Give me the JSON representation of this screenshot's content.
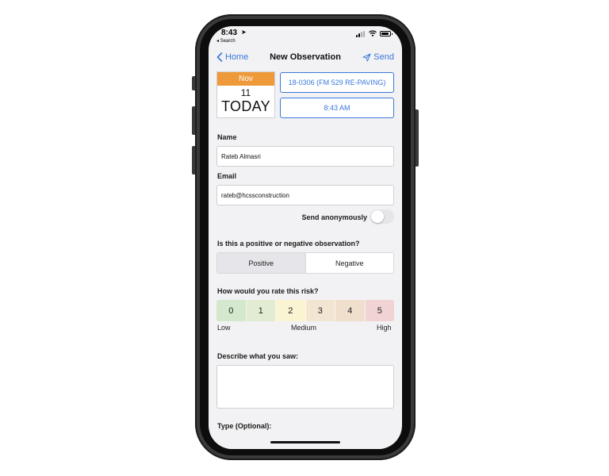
{
  "status_bar": {
    "time": "8:43",
    "location_glyph": "➤",
    "back_label": "◂ Search"
  },
  "nav": {
    "back_label": "Home",
    "title": "New Observation",
    "send_label": "Send"
  },
  "date_tile": {
    "month": "Nov",
    "day": "11",
    "label": "TODAY"
  },
  "job_button_label": "18-0306 (FM 529 RE-PAVING)",
  "time_button_label": "8:43 AM",
  "form": {
    "name_label": "Name",
    "name_value": "Rateb Almasri",
    "email_label": "Email",
    "email_value": "rateb@hcssconstruction",
    "anonymous_label": "Send anonymously",
    "anonymous_on": false,
    "polarity_question": "Is this a positive or negative observation?",
    "polarity_options": [
      "Positive",
      "Negative"
    ],
    "polarity_selected": "Negative",
    "risk_question": "How would you rate this risk?",
    "risk_levels": [
      {
        "value": "0",
        "color": "#d4e8cd"
      },
      {
        "value": "1",
        "color": "#e2ecd2"
      },
      {
        "value": "2",
        "color": "#fbf4d2"
      },
      {
        "value": "3",
        "color": "#f2e6d2"
      },
      {
        "value": "4",
        "color": "#efdfcc"
      },
      {
        "value": "5",
        "color": "#f1d3d3"
      }
    ],
    "risk_low": "Low",
    "risk_medium": "Medium",
    "risk_high": "High",
    "describe_label": "Describe what you saw:",
    "describe_value": "",
    "type_label": "Type (Optional):"
  },
  "colors": {
    "accent": "#3a78d8",
    "calendar_header": "#ef9a3a",
    "screen_background": "#f2f2f4"
  },
  "icons": [
    "location-arrow-icon",
    "signal-icon",
    "wifi-icon",
    "battery-icon",
    "chevron-left-icon",
    "paper-plane-icon"
  ]
}
